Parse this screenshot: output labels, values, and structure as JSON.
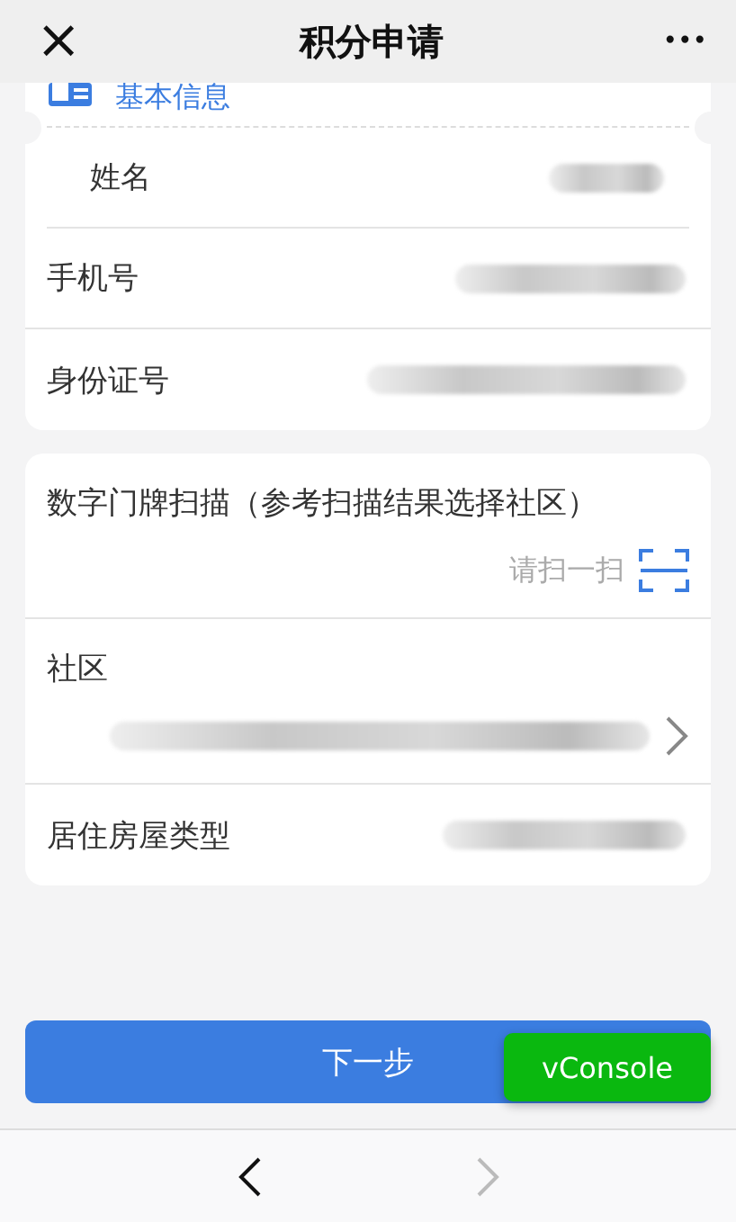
{
  "header": {
    "title": "积分申请",
    "close": "×",
    "more": "•••"
  },
  "basic_info": {
    "title": "基本信息",
    "fields": [
      {
        "label": "姓名",
        "indented": true
      },
      {
        "label": "手机号",
        "indented": false
      },
      {
        "label": "身份证号",
        "indented": false
      }
    ]
  },
  "address": {
    "scan": {
      "label": "数字门牌扫描（参考扫描结果选择社区）",
      "action": "请扫一扫"
    },
    "community": {
      "label": "社区",
      "has_arrow": true
    },
    "housing_type": {
      "label": "居住房屋类型"
    }
  },
  "next_button": "下一步",
  "vconsole": "vConsole",
  "nav": {
    "back": {
      "disabled": false
    },
    "forward": {
      "disabled": true
    }
  }
}
